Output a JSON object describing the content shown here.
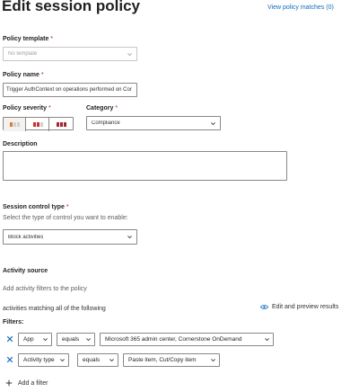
{
  "header": {
    "title": "Edit session policy",
    "view_matches": "View policy matches (0)"
  },
  "policy_template": {
    "label": "Policy template",
    "required_mark": "*",
    "placeholder": "No template"
  },
  "policy_name": {
    "label": "Policy name",
    "required_mark": "*",
    "value": "Trigger AuthContext on operations performed on Cor"
  },
  "policy_severity": {
    "label": "Policy severity",
    "required_mark": "*",
    "levels": [
      {
        "name": "low",
        "filled": 1,
        "color": "#e07b28"
      },
      {
        "name": "medium",
        "filled": 2,
        "color": "#c83232"
      },
      {
        "name": "high",
        "filled": 3,
        "color": "#a4262c"
      }
    ],
    "selected": "low"
  },
  "category": {
    "label": "Category",
    "required_mark": "*",
    "value": "Compliance"
  },
  "description": {
    "label": "Description",
    "value": ""
  },
  "session_control": {
    "label": "Session control type",
    "required_mark": "*",
    "help": "Select the type of control you want to enable:",
    "value": "Block activities"
  },
  "activity_source": {
    "title": "Activity source",
    "hint": "Add activity filters to the policy",
    "matching": "activities matching all of the following",
    "edit_preview": "Edit and preview results",
    "filters_label": "Filters:",
    "filters": [
      {
        "field": "App",
        "operator": "equals",
        "value": "Microsoft 365 admin center, Cornerstone OnDemand"
      },
      {
        "field": "Activity type",
        "operator": "equals",
        "value": "Paste item, Cut/Copy item"
      }
    ],
    "add_filter": "Add a filter"
  },
  "colors": {
    "accent": "#0f6cbd",
    "required": "#a4262c",
    "border": "#8a8886"
  }
}
